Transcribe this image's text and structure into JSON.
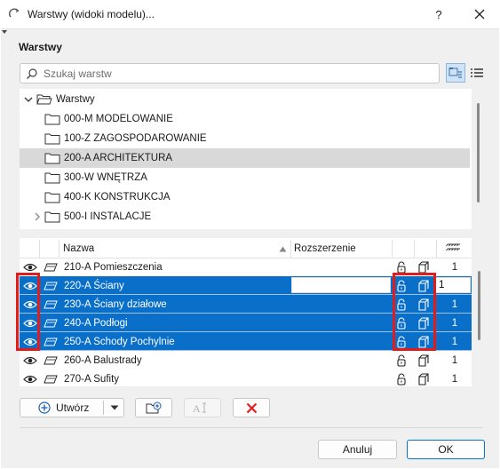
{
  "window": {
    "title": "Warstwy (widoki modelu)...",
    "help_label": "?",
    "close_icon": "close-icon"
  },
  "section": {
    "title": "Warstwy"
  },
  "search": {
    "placeholder": "Szukaj warstw",
    "value": ""
  },
  "view_toggle": {
    "active": "tree-view",
    "icons": [
      "tree-view-icon",
      "list-view-icon"
    ]
  },
  "tree": {
    "root": {
      "label": "Warstwy",
      "expanded": true
    },
    "items": [
      {
        "label": "000-M MODELOWANIE",
        "selected": false,
        "has_children": false
      },
      {
        "label": "100-Z ZAGOSPODAROWANIE",
        "selected": false,
        "has_children": false
      },
      {
        "label": "200-A ARCHITEKTURA",
        "selected": true,
        "has_children": false
      },
      {
        "label": "300-W WNĘTRZA",
        "selected": false,
        "has_children": false
      },
      {
        "label": "400-K KONSTRUKCJA",
        "selected": false,
        "has_children": false
      },
      {
        "label": "500-I INSTALACJE",
        "selected": false,
        "has_children": true
      }
    ]
  },
  "table": {
    "columns": {
      "name": "Nazwa",
      "extension": "Rozszerzenie"
    },
    "rows": [
      {
        "name": "210-A Pomieszczenia",
        "value": "1",
        "selected": false
      },
      {
        "name": "220-A Ściany",
        "value": "1",
        "selected": true,
        "editing": true
      },
      {
        "name": "230-A Ściany działowe",
        "value": "1",
        "selected": true
      },
      {
        "name": "240-A Podłogi",
        "value": "1",
        "selected": true
      },
      {
        "name": "250-A Schody Pochylnie",
        "value": "1",
        "selected": true
      },
      {
        "name": "260-A Balustrady",
        "value": "1",
        "selected": false
      },
      {
        "name": "270-A Sufity",
        "value": "1",
        "selected": false
      }
    ]
  },
  "toolbar": {
    "create_label": "Utwórz",
    "icons": [
      "plus-circle-icon",
      "dropdown-arrow-icon",
      "new-folder-icon",
      "rename-icon",
      "delete-icon"
    ]
  },
  "footer": {
    "cancel_label": "Anuluj",
    "ok_label": "OK"
  },
  "colors": {
    "selection": "#0a6fc9",
    "highlight_box": "#e21b1b",
    "delete": "#e81d1d"
  }
}
